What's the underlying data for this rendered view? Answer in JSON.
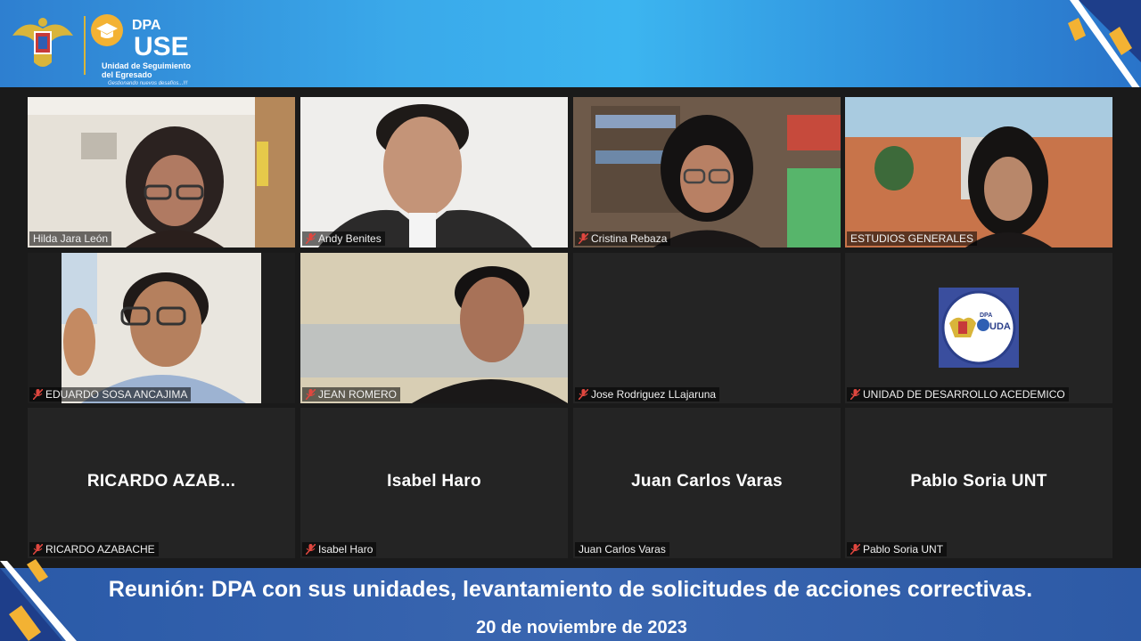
{
  "branding": {
    "dpa": "DPA",
    "use": "USE",
    "unit_line1": "Unidad de Seguimiento",
    "unit_line2": "del Egresado",
    "tagline": "Gestionando nuevos desafíos...!!!"
  },
  "participants": [
    {
      "name": "Hilda  Jara  León",
      "muted": false,
      "video": true,
      "active": true
    },
    {
      "name": "Andy Benites",
      "muted": true,
      "video": true
    },
    {
      "name": "Cristina Rebaza",
      "muted": true,
      "video": true
    },
    {
      "name": "ESTUDIOS GENERALES",
      "muted": false,
      "video": true
    },
    {
      "name": "EDUARDO SOSA ANCAJIMA",
      "muted": true,
      "video": true
    },
    {
      "name": "JEAN ROMERO",
      "muted": true,
      "video": true
    },
    {
      "name": "Jose Rodriguez LLajaruna",
      "muted": true,
      "video": false
    },
    {
      "name": "UNIDAD DE DESARROLLO ACEDEMICO",
      "muted": true,
      "video": false,
      "logo_text": "UDA",
      "logo_dpa": "DPA"
    },
    {
      "name": "RICARDO AZABACHE",
      "muted": true,
      "video": false,
      "display": "RICARDO  AZAB..."
    },
    {
      "name": "Isabel Haro",
      "muted": true,
      "video": false,
      "display": "Isabel Haro"
    },
    {
      "name": "Juan Carlos Varas",
      "muted": false,
      "video": false,
      "display": "Juan Carlos Varas"
    },
    {
      "name": "Pablo Soria UNT",
      "muted": true,
      "video": false,
      "display": "Pablo Soria UNT"
    }
  ],
  "footer": {
    "title": "Reunión: DPA con sus unidades, levantamiento de solicitudes de acciones correctivas.",
    "date": "20 de noviembre de 2023"
  },
  "colors": {
    "active_border": "#e8e37b",
    "muted_icon": "#e0473f",
    "accent_yellow": "#f3b233"
  }
}
